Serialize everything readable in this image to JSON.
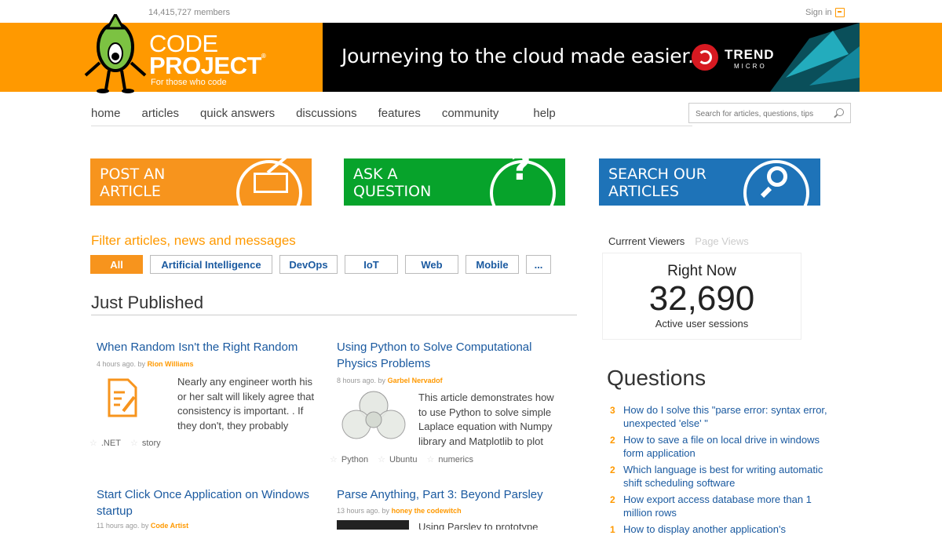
{
  "topbar": {
    "members": "14,415,727 members",
    "signin": "Sign in"
  },
  "logo": {
    "line1": "CODE",
    "line2": "PROJECT",
    "reg": "®",
    "tagline": "For those who code"
  },
  "banner": {
    "text": "Journeying to the cloud made easier.",
    "brand": "TREND",
    "brand_sub": "MICRO"
  },
  "nav": {
    "items": [
      "home",
      "articles",
      "quick answers",
      "discussions",
      "features",
      "community",
      "help"
    ]
  },
  "search": {
    "placeholder": "Search for articles, questions, tips"
  },
  "actions": {
    "post": [
      "POST AN",
      "ARTICLE"
    ],
    "ask": [
      "ASK A",
      "QUESTION"
    ],
    "search": [
      "SEARCH OUR",
      "ARTICLES"
    ]
  },
  "filter": {
    "title": "Filter articles, news and messages",
    "tags": [
      "All",
      "Artificial Intelligence",
      "DevOps",
      "IoT",
      "Web",
      "Mobile",
      "..."
    ]
  },
  "just_published": {
    "title": "Just Published",
    "articles": [
      {
        "title": "When Random Isn't the Right Random",
        "meta": "4 hours ago. by",
        "author": "Rion Williams",
        "desc": "Nearly any engineer worth his or her salt will likely agree that consistency is important. . If they don't, they probably",
        "tags": [
          ".NET",
          "story"
        ]
      },
      {
        "title": "Using Python to Solve Computational Physics Problems",
        "meta": "8 hours ago. by",
        "author": "Garbel Nervadof",
        "desc": "This article demonstrates how to use Python to solve simple Laplace equation with Numpy library and Matplotlib to plot",
        "tags": [
          "Python",
          "Ubuntu",
          "numerics"
        ]
      },
      {
        "title": "Start Click Once Application on Windows startup",
        "meta": "11 hours ago. by",
        "author": "Code Artist"
      },
      {
        "title": "Parse Anything, Part 3: Beyond Parsley",
        "meta": "13 hours ago. by",
        "author": "honey the codewitch",
        "desc": "Using Parsley to prototype"
      }
    ]
  },
  "viewers": {
    "tab_current": "Currrent Viewers",
    "tab_pages": "Page Views",
    "label": "Right Now",
    "count": "32,690",
    "sub": "Active user sessions"
  },
  "questions": {
    "title": "Questions",
    "items": [
      {
        "count": "3",
        "text": "How do I solve this \"parse error: syntax error, unexpected 'else' \""
      },
      {
        "count": "2",
        "text": "How to save a file on local drive in windows form application"
      },
      {
        "count": "2",
        "text": "Which language is best for writing automatic shift scheduling software"
      },
      {
        "count": "2",
        "text": "How export access database more than 1 million rows"
      },
      {
        "count": "1",
        "text": "How to display another application's"
      }
    ]
  },
  "colors": {
    "brand_orange": "#f90",
    "link_blue": "#1b5aa0",
    "ask_green": "#07a32b",
    "search_blue": "#1e73b8"
  }
}
